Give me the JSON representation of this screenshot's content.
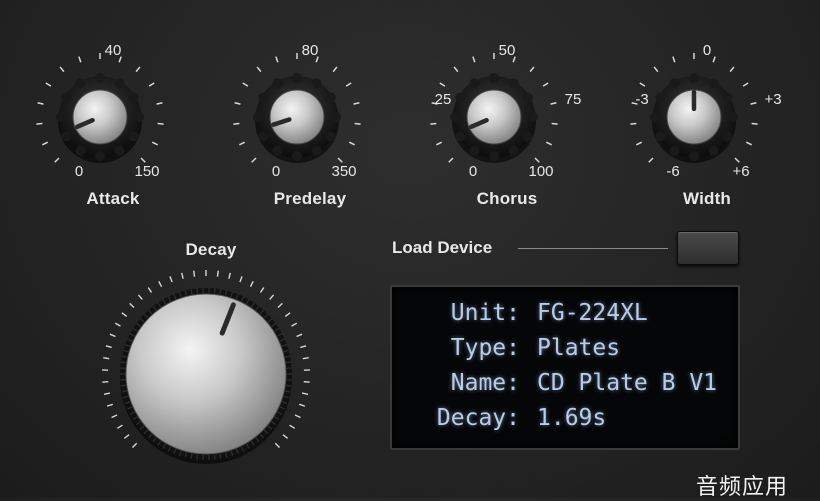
{
  "knobs": [
    {
      "id": "attack",
      "label": "Attack",
      "top_label": "40",
      "left_label": "",
      "right_label": "",
      "min_label": "0",
      "max_label": "150",
      "value_fraction": 0.08
    },
    {
      "id": "predelay",
      "label": "Predelay",
      "top_label": "80",
      "left_label": "",
      "right_label": "",
      "min_label": "0",
      "max_label": "350",
      "value_fraction": 0.1
    },
    {
      "id": "chorus",
      "label": "Chorus",
      "top_label": "50",
      "left_label": "25",
      "right_label": "75",
      "min_label": "0",
      "max_label": "100",
      "value_fraction": 0.08
    },
    {
      "id": "width",
      "label": "Width",
      "top_label": "0",
      "left_label": "-3",
      "right_label": "+3",
      "min_label": "-6",
      "max_label": "+6",
      "value_fraction": 0.5
    }
  ],
  "decay_knob": {
    "label": "Decay",
    "value_fraction": 0.58
  },
  "load_device": {
    "label": "Load Device"
  },
  "display": {
    "rows": [
      {
        "key": "Unit:",
        "value": "FG-224XL"
      },
      {
        "key": "Type:",
        "value": "Plates"
      },
      {
        "key": "Name:",
        "value": "CD Plate B V1"
      },
      {
        "key": "Decay:",
        "value": "1.69s"
      }
    ],
    "text_color": "#b8cce8"
  },
  "watermark": "音频应用"
}
